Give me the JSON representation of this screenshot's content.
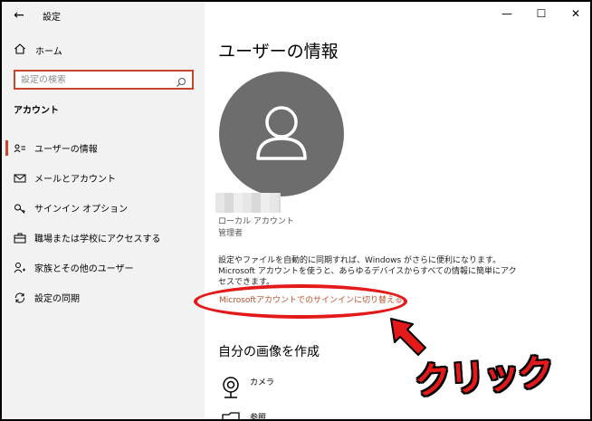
{
  "window": {
    "title": "設定",
    "controls": {
      "minimize": "—",
      "maximize": "☐",
      "close": "✕"
    }
  },
  "sidebar": {
    "home_label": "ホーム",
    "search": {
      "placeholder": "設定の検索",
      "value": ""
    },
    "section_label": "アカウント",
    "items": [
      {
        "label": "ユーザーの情報",
        "icon": "user-card-icon",
        "active": true
      },
      {
        "label": "メールとアカウント",
        "icon": "mail-icon",
        "active": false
      },
      {
        "label": "サインイン オプション",
        "icon": "key-icon",
        "active": false
      },
      {
        "label": "職場または学校にアクセスする",
        "icon": "briefcase-icon",
        "active": false
      },
      {
        "label": "家族とその他のユーザー",
        "icon": "person-add-icon",
        "active": false
      },
      {
        "label": "設定の同期",
        "icon": "sync-icon",
        "active": false
      }
    ]
  },
  "main": {
    "page_title": "ユーザーの情報",
    "account_type": "ローカル アカウント",
    "account_role": "管理者",
    "sync_description": "設定やファイルを自動的に同期すれば、Windows がさらに便利になります。Microsoft アカウントを使うと、あらゆるデバイスからすべての情報に簡単にアクセスできます。",
    "ms_signin_link": "Microsoftアカウントでのサインインに切り替える",
    "create_picture_title": "自分の画像を作成",
    "camera_label": "カメラ",
    "browse_label": "参照"
  },
  "annotation": {
    "click_label": "クリック",
    "highlight_color": "#e41a1a"
  },
  "colors": {
    "accent": "#c8462c",
    "link": "#b9502d",
    "sidebar_bg": "#f2f2f2",
    "avatar_bg": "#6d6d6d"
  }
}
